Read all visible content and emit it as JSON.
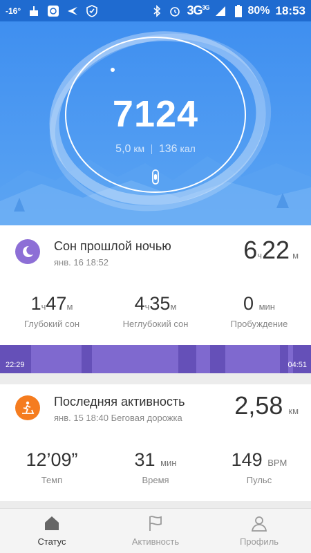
{
  "status_bar": {
    "temperature": "-16°",
    "network": "3G",
    "network_sup": "3G",
    "battery": "80%",
    "time": "18:53"
  },
  "hero": {
    "steps": "7124",
    "distance_value": "5,0",
    "distance_unit": "км",
    "calories_value": "136",
    "calories_unit": "кал"
  },
  "sleep": {
    "title": "Сон прошлой ночью",
    "date": "янв. 16 18:52",
    "total_hours": "6",
    "hours_unit": "ч",
    "total_minutes": "22",
    "minutes_unit": "м",
    "stats": [
      {
        "h": "1",
        "h_unit": "ч",
        "m": "47",
        "m_unit": "м",
        "label": "Глубокий сон"
      },
      {
        "h": "4",
        "h_unit": "ч",
        "m": "35",
        "m_unit": "м",
        "label": "Неглубокий сон"
      },
      {
        "value": "0",
        "unit": "мин",
        "label": "Пробуждение"
      }
    ],
    "bar_start": "22:29",
    "bar_end": "04:51"
  },
  "activity": {
    "title": "Последняя активность",
    "subtitle": "янв. 15 18:40 Беговая дорожка",
    "distance": "2,58",
    "distance_unit": "км",
    "stats": [
      {
        "value": "12’09”",
        "unit": "",
        "label": "Темп"
      },
      {
        "value": "31",
        "unit": "мин",
        "label": "Время"
      },
      {
        "value": "149",
        "unit": "BPM",
        "label": "Пульс"
      }
    ]
  },
  "nav": {
    "items": [
      {
        "label": "Статус"
      },
      {
        "label": "Активность"
      },
      {
        "label": "Профиль"
      }
    ]
  }
}
